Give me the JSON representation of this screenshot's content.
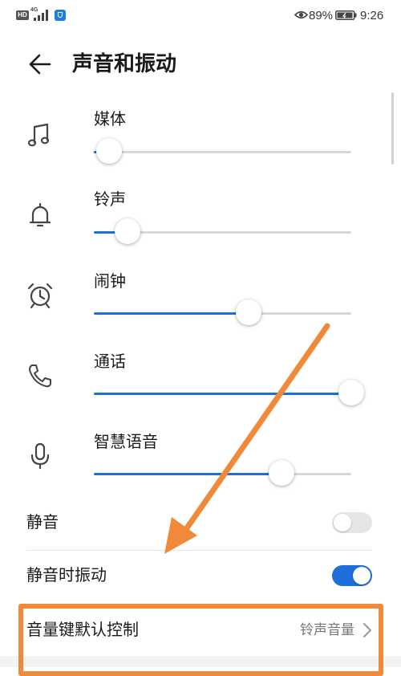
{
  "status_bar": {
    "network": "4G",
    "battery_percent": "89%",
    "time": "9:26"
  },
  "header": {
    "title": "声音和振动"
  },
  "volume_rows": [
    {
      "label": "媒体",
      "icon": "music-note-icon",
      "level": 0.06
    },
    {
      "label": "铃声",
      "icon": "bell-icon",
      "level": 0.13
    },
    {
      "label": "闹钟",
      "icon": "alarm-clock-icon",
      "level": 0.6
    },
    {
      "label": "通话",
      "icon": "phone-icon",
      "level": 1.0
    },
    {
      "label": "智慧语音",
      "icon": "microphone-icon",
      "level": 0.73
    }
  ],
  "toggles": {
    "mute": {
      "label": "静音",
      "on": false
    },
    "vibrate_on_mute": {
      "label": "静音时振动",
      "on": true
    }
  },
  "volume_key_control": {
    "label": "音量键默认控制",
    "value": "铃声音量"
  },
  "colors": {
    "accent": "#1e6fd9",
    "annotation": "#f0893a"
  }
}
